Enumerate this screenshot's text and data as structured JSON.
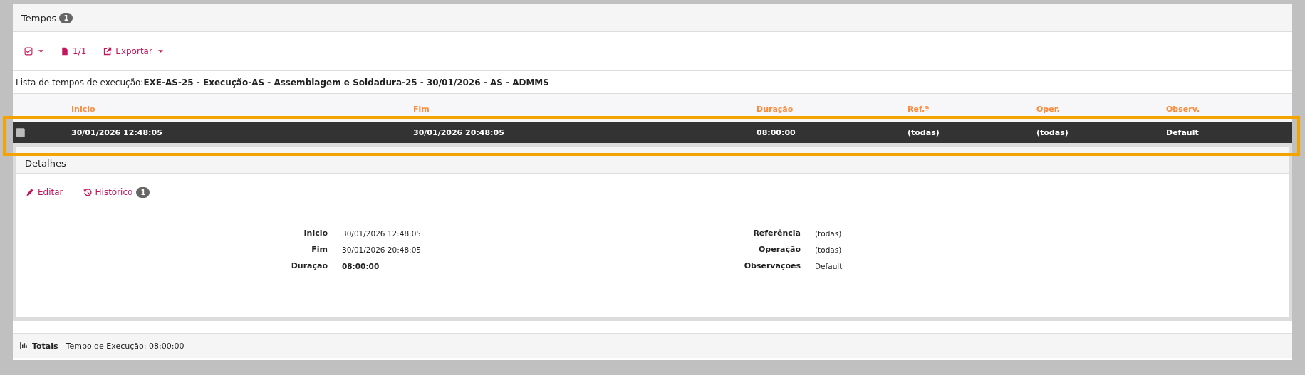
{
  "panel": {
    "title": "Tempos",
    "count": "1"
  },
  "toolbar": [
    {
      "kind": "select-menu"
    },
    {
      "kind": "pages",
      "label": "1/1"
    },
    {
      "kind": "export",
      "label": "Exportar"
    }
  ],
  "list_caption": {
    "label": "Lista de tempos de execução:",
    "value": "EXE-AS-25 - Execução-AS - Assemblagem e Soldadura-25 - 30/01/2026 - AS - ADMMS"
  },
  "table": {
    "columns": [
      "Inicio",
      "Fim",
      "Duração",
      "Ref.ª",
      "Oper.",
      "Observ."
    ],
    "rows": [
      {
        "selected": true,
        "checked": false,
        "highlighted": true,
        "cells": [
          "30/01/2026 12:48:05",
          "30/01/2026 20:48:05",
          "08:00:00",
          "(todas)",
          "(todas)",
          "Default"
        ]
      }
    ]
  },
  "details": {
    "title": "Detalhes",
    "actions": [
      {
        "kind": "edit",
        "label": "Editar"
      },
      {
        "kind": "history",
        "label": "Histórico",
        "count": "1"
      }
    ],
    "left": [
      {
        "label": "Inicio",
        "value": "30/01/2026 12:48:05",
        "bold": false
      },
      {
        "label": "Fim",
        "value": "30/01/2026 20:48:05",
        "bold": false
      },
      {
        "label": "Duração",
        "value": "08:00:00",
        "bold": true
      }
    ],
    "right": [
      {
        "label": "Referência",
        "value": "(todas)",
        "bold": false
      },
      {
        "label": "Operação",
        "value": "(todas)",
        "bold": false
      },
      {
        "label": "Observações",
        "value": "Default",
        "bold": false
      }
    ]
  },
  "totals": {
    "text": "**Totais** - Tempo de Execução: 08:00:00"
  }
}
